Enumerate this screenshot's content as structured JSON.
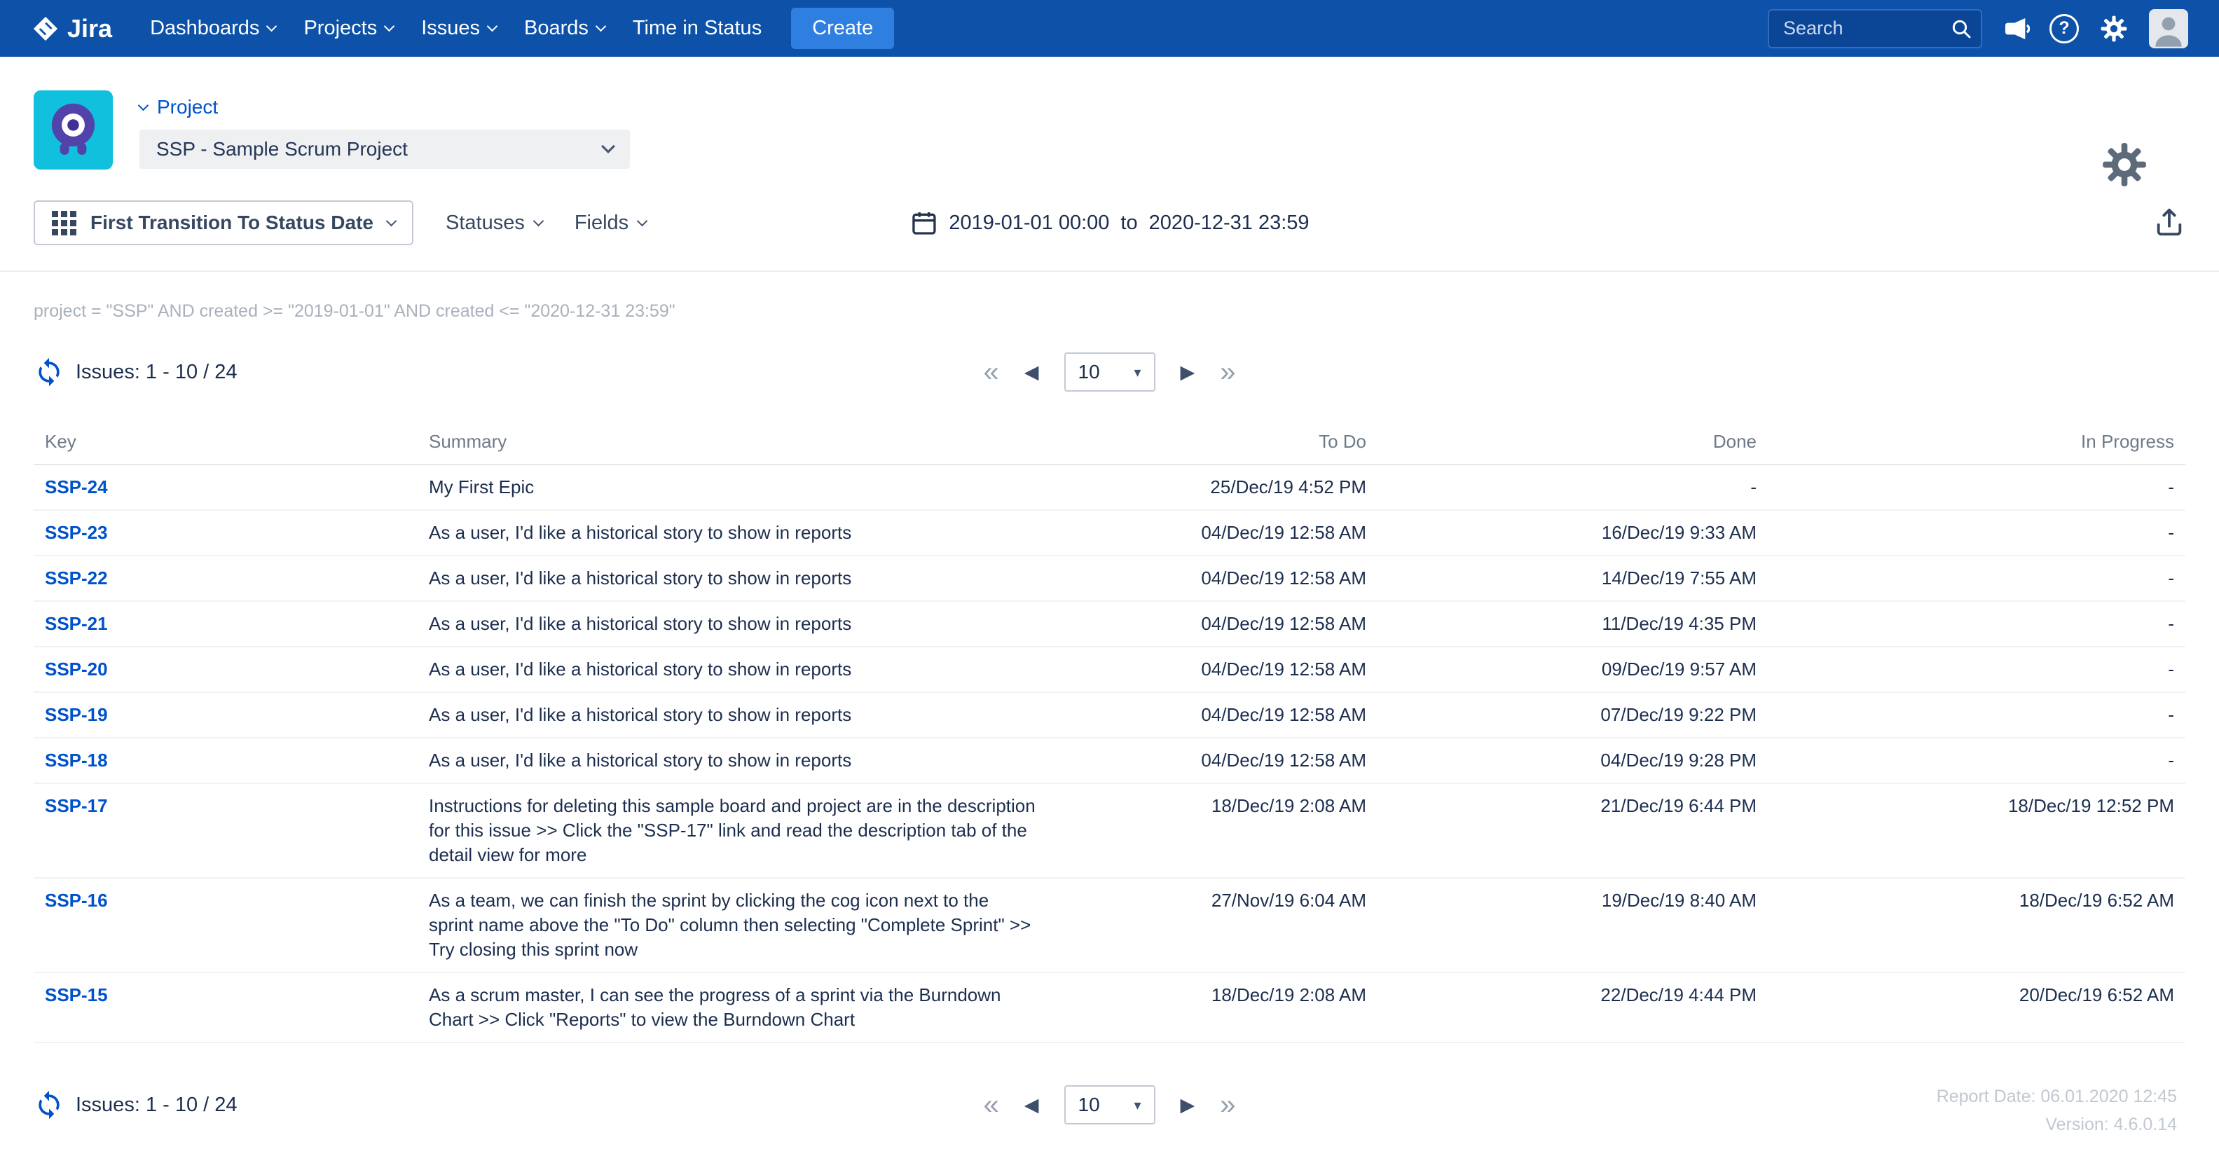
{
  "nav": {
    "logo_text": "Jira",
    "items": [
      {
        "label": "Dashboards"
      },
      {
        "label": "Projects"
      },
      {
        "label": "Issues"
      },
      {
        "label": "Boards"
      },
      {
        "label": "Time in Status"
      }
    ],
    "create_label": "Create",
    "search_placeholder": "Search"
  },
  "header": {
    "project_label": "Project",
    "project_select_value": "SSP - Sample Scrum Project"
  },
  "toolbar": {
    "report_type_label": "First Transition To Status Date",
    "statuses_label": "Statuses",
    "fields_label": "Fields",
    "date_from": "2019-01-01 00:00",
    "date_to_word": "to",
    "date_to": "2020-12-31 23:59"
  },
  "jql": "project = \"SSP\" AND created >= \"2019-01-01\" AND created <= \"2020-12-31 23:59\"",
  "issues_count": "Issues: 1 - 10 / 24",
  "pagination": {
    "page_size": "10"
  },
  "icons": {
    "pagination_first": "«",
    "pagination_prev": "◀",
    "pagination_next": "▶",
    "pagination_last": "»",
    "select_caret": "▾",
    "help_glyph": "?"
  },
  "table": {
    "columns": [
      "Key",
      "Summary",
      "To Do",
      "Done",
      "In Progress"
    ],
    "rows": [
      {
        "key": "SSP-24",
        "summary": "My First Epic",
        "todo": "25/Dec/19 4:52 PM",
        "done": "-",
        "inprogress": "-"
      },
      {
        "key": "SSP-23",
        "summary": "As a user, I'd like a historical story to show in reports",
        "todo": "04/Dec/19 12:58 AM",
        "done": "16/Dec/19 9:33 AM",
        "inprogress": "-"
      },
      {
        "key": "SSP-22",
        "summary": "As a user, I'd like a historical story to show in reports",
        "todo": "04/Dec/19 12:58 AM",
        "done": "14/Dec/19 7:55 AM",
        "inprogress": "-"
      },
      {
        "key": "SSP-21",
        "summary": "As a user, I'd like a historical story to show in reports",
        "todo": "04/Dec/19 12:58 AM",
        "done": "11/Dec/19 4:35 PM",
        "inprogress": "-"
      },
      {
        "key": "SSP-20",
        "summary": "As a user, I'd like a historical story to show in reports",
        "todo": "04/Dec/19 12:58 AM",
        "done": "09/Dec/19 9:57 AM",
        "inprogress": "-"
      },
      {
        "key": "SSP-19",
        "summary": "As a user, I'd like a historical story to show in reports",
        "todo": "04/Dec/19 12:58 AM",
        "done": "07/Dec/19 9:22 PM",
        "inprogress": "-"
      },
      {
        "key": "SSP-18",
        "summary": "As a user, I'd like a historical story to show in reports",
        "todo": "04/Dec/19 12:58 AM",
        "done": "04/Dec/19 9:28 PM",
        "inprogress": "-"
      },
      {
        "key": "SSP-17",
        "summary": "Instructions for deleting this sample board and project are in the description for this issue >> Click the \"SSP-17\" link and read the description tab of the detail view for more",
        "todo": "18/Dec/19 2:08 AM",
        "done": "21/Dec/19 6:44 PM",
        "inprogress": "18/Dec/19 12:52 PM"
      },
      {
        "key": "SSP-16",
        "summary": "As a team, we can finish the sprint by clicking the cog icon next to the sprint name above the \"To Do\" column then selecting \"Complete Sprint\" >> Try closing this sprint now",
        "todo": "27/Nov/19 6:04 AM",
        "done": "19/Dec/19 8:40 AM",
        "inprogress": "18/Dec/19 6:52 AM"
      },
      {
        "key": "SSP-15",
        "summary": "As a scrum master, I can see the progress of a sprint via the Burndown Chart >> Click \"Reports\" to view the Burndown Chart",
        "todo": "18/Dec/19 2:08 AM",
        "done": "22/Dec/19 4:44 PM",
        "inprogress": "20/Dec/19 6:52 AM"
      }
    ]
  },
  "footer": {
    "issues_count": "Issues: 1 - 10 / 24",
    "report_date": "Report Date: 06.01.2020 12:45",
    "version": "Version: 4.6.0.14"
  }
}
